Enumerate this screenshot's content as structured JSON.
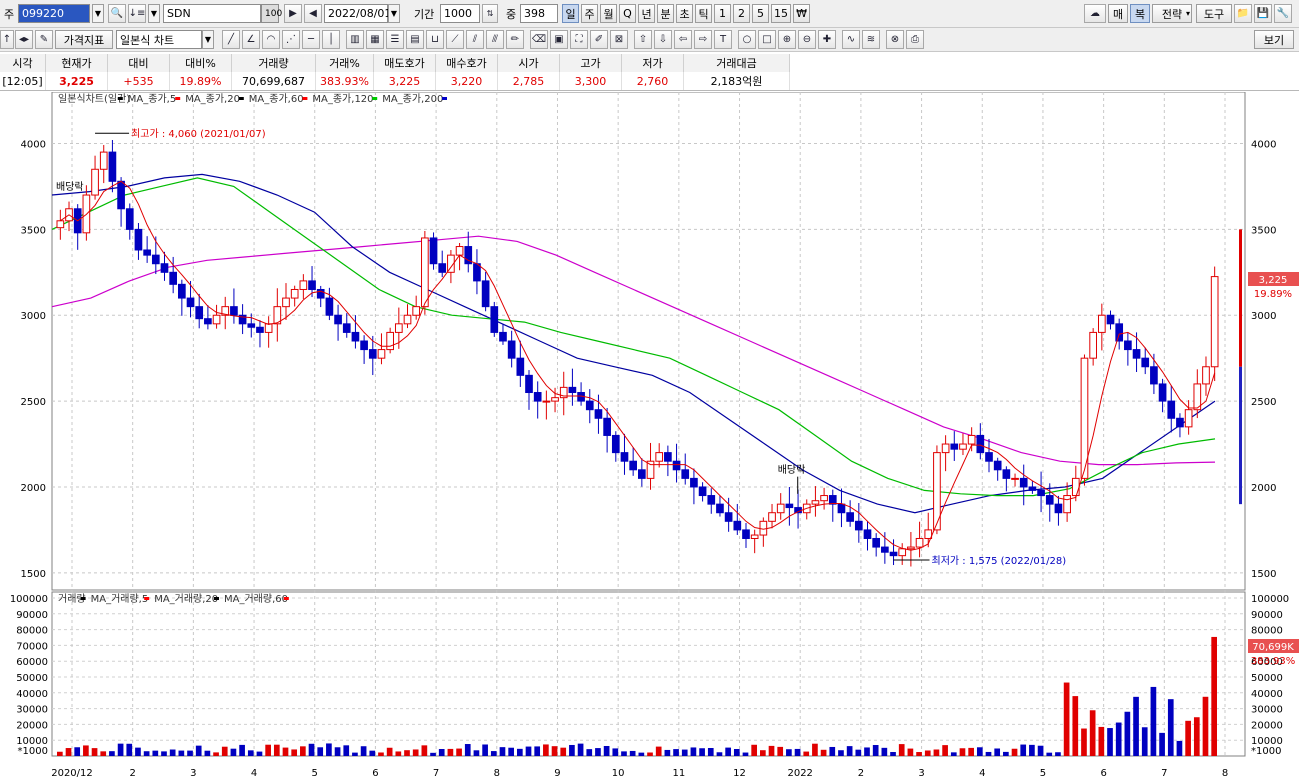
{
  "toolbar_top": {
    "code_prefix": "주",
    "stock_code": "099220",
    "stock_name": "SDN",
    "name_num": "100",
    "date": "2022/08/01",
    "period_label": "기간",
    "period_value": "1000",
    "mid_label": "중",
    "mid_value": "398",
    "periods": [
      "일",
      "주",
      "월",
      "Q",
      "년",
      "분",
      "초",
      "틱",
      "1",
      "2",
      "5",
      "15",
      "₩"
    ],
    "right_buttons": [
      "매",
      "복",
      "전략",
      "도구"
    ]
  },
  "toolbar_second": {
    "price_indicator": "가격지표",
    "chart_type": "일본식 차트",
    "view": "보기"
  },
  "quote": {
    "headers": [
      "시각",
      "현재가",
      "대비",
      "대비%",
      "거래량",
      "거래%",
      "매도호가",
      "매수호가",
      "시가",
      "고가",
      "저가",
      "거래대금"
    ],
    "values": [
      "[12:05]",
      "3,225",
      "+535",
      "19.89%",
      "70,699,687",
      "383.93%",
      "3,225",
      "3,220",
      "2,785",
      "3,300",
      "2,760",
      "2,183억원"
    ]
  },
  "chart_data": {
    "type": "candlestick",
    "price_legend": [
      {
        "text": "일본식차트(일간)",
        "color": "#000000"
      },
      {
        "text": "MA_종가,5",
        "color": "#ff0000"
      },
      {
        "text": "MA_종가,20",
        "color": "#000000"
      },
      {
        "text": "MA_종가,60",
        "color": "#ff0000"
      },
      {
        "text": "MA_종가,120",
        "color": "#00cc00"
      },
      {
        "text": "MA_종가,200",
        "color": "#0000c8"
      }
    ],
    "volume_legend": [
      {
        "text": "거래량",
        "color": "#000000"
      },
      {
        "text": "MA_거래량,5",
        "color": "#ff0000"
      },
      {
        "text": "MA_거래량,20",
        "color": "#000000"
      },
      {
        "text": "MA_거래량,60",
        "color": "#ff0000"
      }
    ],
    "price_ticks": [
      1500,
      2000,
      2500,
      3000,
      3500,
      4000
    ],
    "volume_ticks": [
      10000,
      20000,
      30000,
      40000,
      50000,
      60000,
      70000,
      80000,
      90000,
      100000
    ],
    "volume_unit": "*1000",
    "x_labels": [
      "2020/12",
      "2",
      "3",
      "4",
      "5",
      "6",
      "7",
      "8",
      "9",
      "10",
      "11",
      "12",
      "2022",
      "2",
      "3",
      "4",
      "5",
      "6",
      "7",
      "8"
    ],
    "high_annotation": "최고가 : 4,060 (2021/01/07)",
    "low_annotation": "최저가 : 1,575 (2022/01/28)",
    "dividend_label": "배당락",
    "current_price": "3,225",
    "current_change": "19.89%",
    "current_volume": "70,699K",
    "current_volume_pct": "383.93%",
    "price_range": [
      1400,
      4300
    ],
    "volume_range": [
      0,
      100000
    ],
    "closes": [
      3550,
      3620,
      3480,
      3700,
      3850,
      3950,
      3780,
      3620,
      3500,
      3380,
      3350,
      3300,
      3250,
      3180,
      3100,
      3050,
      2980,
      2950,
      3000,
      3050,
      3000,
      2950,
      2930,
      2900,
      2950,
      3050,
      3100,
      3150,
      3200,
      3150,
      3100,
      3000,
      2950,
      2900,
      2850,
      2800,
      2750,
      2800,
      2900,
      2950,
      3000,
      3050,
      3450,
      3300,
      3250,
      3350,
      3400,
      3300,
      3200,
      3050,
      2900,
      2850,
      2750,
      2650,
      2550,
      2500,
      2500,
      2520,
      2580,
      2550,
      2500,
      2450,
      2400,
      2300,
      2200,
      2150,
      2100,
      2050,
      2150,
      2200,
      2150,
      2100,
      2050,
      2000,
      1950,
      1900,
      1850,
      1800,
      1750,
      1700,
      1720,
      1800,
      1850,
      1900,
      1880,
      1850,
      1900,
      1920,
      1950,
      1900,
      1850,
      1800,
      1750,
      1700,
      1650,
      1620,
      1600,
      1640,
      1650,
      1700,
      1750,
      2200,
      2250,
      2220,
      2250,
      2300,
      2200,
      2150,
      2100,
      2050,
      2050,
      2000,
      1980,
      1950,
      1900,
      1850,
      1950,
      2050,
      2750,
      2900,
      3000,
      2950,
      2850,
      2800,
      2750,
      2700,
      2600,
      2500,
      2400,
      2350,
      2450,
      2600,
      2700,
      3225
    ],
    "ma_trend_200": [
      3050,
      3100,
      3200,
      3280,
      3320,
      3340,
      3360,
      3380,
      3400,
      3420,
      3440,
      3460,
      3430,
      3350,
      3250,
      3150,
      3050,
      2950,
      2850,
      2750,
      2650,
      2550,
      2450,
      2350,
      2280,
      2200,
      2150,
      2130,
      2130,
      2140,
      2145
    ],
    "ma_trend_120": [
      3700,
      3720,
      3750,
      3800,
      3820,
      3780,
      3700,
      3600,
      3400,
      3250,
      3150,
      3050,
      2950,
      2850,
      2750,
      2700,
      2650,
      2550,
      2400,
      2250,
      2100,
      1980,
      1900,
      1850,
      1900,
      1950,
      1980,
      2000,
      2050,
      2200,
      2350,
      2500
    ],
    "ma_trend_60": [
      3500,
      3600,
      3700,
      3750,
      3800,
      3750,
      3600,
      3450,
      3300,
      3150,
      3050,
      3000,
      2980,
      2960,
      2900,
      2850,
      2800,
      2750,
      2650,
      2550,
      2450,
      2300,
      2150,
      2050,
      1980,
      1960,
      1950,
      1950,
      1990,
      2100,
      2200,
      2250,
      2280
    ]
  }
}
